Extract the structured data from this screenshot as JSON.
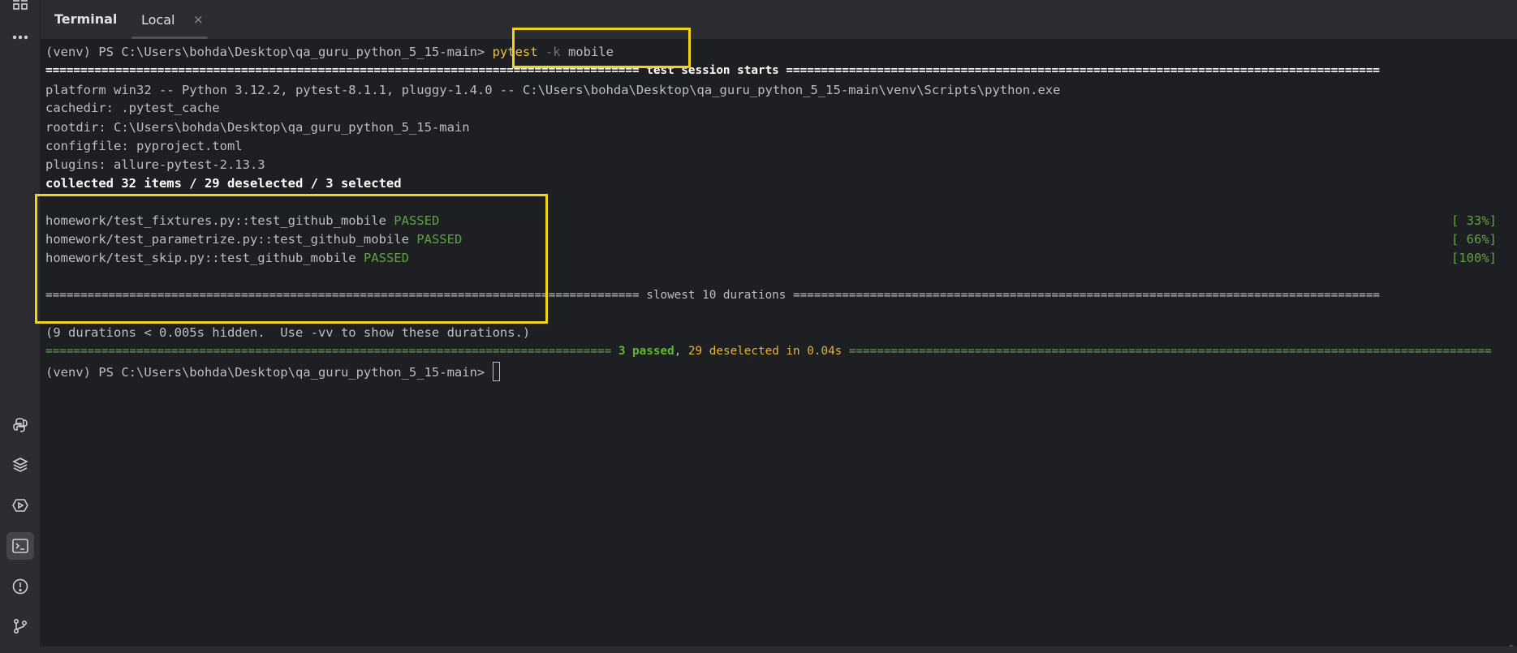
{
  "header": {
    "title": "Terminal",
    "tab_label": "Local",
    "tab_close": "×"
  },
  "toolstrip": {
    "icons": [
      "grid-icon",
      "more-icon",
      "python-icon",
      "layers-icon",
      "run-icon",
      "terminal-icon",
      "problems-icon",
      "git-icon"
    ]
  },
  "terminal": {
    "prompt": "(venv) PS C:\\Users\\bohda\\Desktop\\qa_guru_python_5_15-main>",
    "cmd_name": "pytest",
    "cmd_flag": "-k",
    "cmd_arg": "mobile",
    "session_left": "=====================================================================================",
    "session_title": "test session starts",
    "session_right": "=====================================================================================",
    "platform": "platform win32 -- Python 3.12.2, pytest-8.1.1, pluggy-1.4.0 -- C:\\Users\\bohda\\Desktop\\qa_guru_python_5_15-main\\venv\\Scripts\\python.exe",
    "cachedir": "cachedir: .pytest_cache",
    "rootdir": "rootdir: C:\\Users\\bohda\\Desktop\\qa_guru_python_5_15-main",
    "configfile": "configfile: pyproject.toml",
    "plugins": "plugins: allure-pytest-2.13.3",
    "collected": "collected 32 items / 29 deselected / 3 selected",
    "tests": [
      {
        "name": "homework/test_fixtures.py::test_github_mobile",
        "status": "PASSED",
        "progress": "[ 33%]"
      },
      {
        "name": "homework/test_parametrize.py::test_github_mobile",
        "status": "PASSED",
        "progress": "[ 66%]"
      },
      {
        "name": "homework/test_skip.py::test_github_mobile",
        "status": "PASSED",
        "progress": "[100%]"
      }
    ],
    "slowest_left": "=====================================================================================",
    "slowest_title": "slowest 10 durations",
    "slowest_right": "====================================================================================",
    "hidden_note": "(9 durations < 0.005s hidden.  Use -vv to show these durations.)",
    "summary_left": "=================================================================================",
    "summary_passed": "3 passed",
    "summary_comma": ",",
    "summary_deselected": "29 deselected in 0.04s",
    "summary_right": "============================================================================================"
  }
}
